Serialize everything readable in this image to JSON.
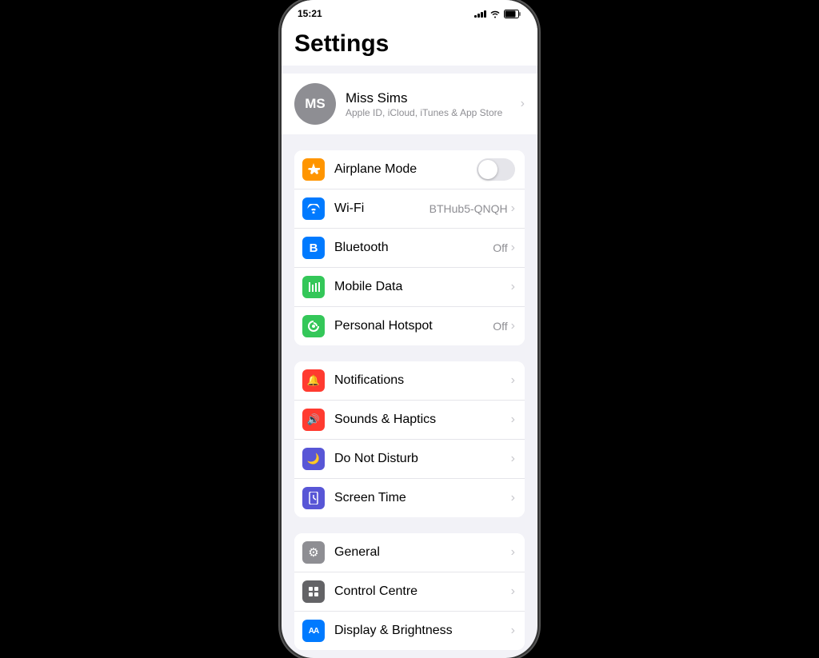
{
  "statusBar": {
    "time": "15:21",
    "icons": {
      "signal": "signal",
      "wifi": "wifi",
      "battery": "battery"
    }
  },
  "page": {
    "title": "Settings"
  },
  "profile": {
    "initials": "MS",
    "name": "Miss Sims",
    "subtitle": "Apple ID, iCloud, iTunes & App Store"
  },
  "groups": [
    {
      "id": "connectivity",
      "items": [
        {
          "id": "airplane-mode",
          "label": "Airplane Mode",
          "icon": "✈",
          "iconClass": "icon-orange",
          "value": "",
          "hasToggle": true,
          "toggleOn": false
        },
        {
          "id": "wifi",
          "label": "Wi-Fi",
          "icon": "📶",
          "iconClass": "icon-blue",
          "value": "BTHub5-QNQH",
          "hasToggle": false
        },
        {
          "id": "bluetooth",
          "label": "Bluetooth",
          "icon": "⊕",
          "iconClass": "icon-blue-dark",
          "value": "Off",
          "hasToggle": false
        },
        {
          "id": "mobile-data",
          "label": "Mobile Data",
          "icon": "📡",
          "iconClass": "icon-green",
          "value": "",
          "hasToggle": false
        },
        {
          "id": "personal-hotspot",
          "label": "Personal Hotspot",
          "icon": "🔗",
          "iconClass": "icon-green2",
          "value": "Off",
          "hasToggle": false
        }
      ]
    },
    {
      "id": "notifications",
      "items": [
        {
          "id": "notifications",
          "label": "Notifications",
          "icon": "🔔",
          "iconClass": "icon-red",
          "value": "",
          "hasToggle": false
        },
        {
          "id": "sounds-haptics",
          "label": "Sounds & Haptics",
          "icon": "🔊",
          "iconClass": "icon-red2",
          "value": "",
          "hasToggle": false
        },
        {
          "id": "do-not-disturb",
          "label": "Do Not Disturb",
          "icon": "🌙",
          "iconClass": "icon-purple",
          "value": "",
          "hasToggle": false
        },
        {
          "id": "screen-time",
          "label": "Screen Time",
          "icon": "⧗",
          "iconClass": "icon-purple2",
          "value": "",
          "hasToggle": false
        }
      ]
    },
    {
      "id": "system",
      "items": [
        {
          "id": "general",
          "label": "General",
          "icon": "⚙",
          "iconClass": "icon-gray",
          "value": "",
          "hasToggle": false
        },
        {
          "id": "control-centre",
          "label": "Control Centre",
          "icon": "⊞",
          "iconClass": "icon-gray2",
          "value": "",
          "hasToggle": false
        },
        {
          "id": "display-brightness",
          "label": "Display & Brightness",
          "icon": "AA",
          "iconClass": "icon-blue2",
          "value": "",
          "hasToggle": false
        }
      ]
    }
  ]
}
